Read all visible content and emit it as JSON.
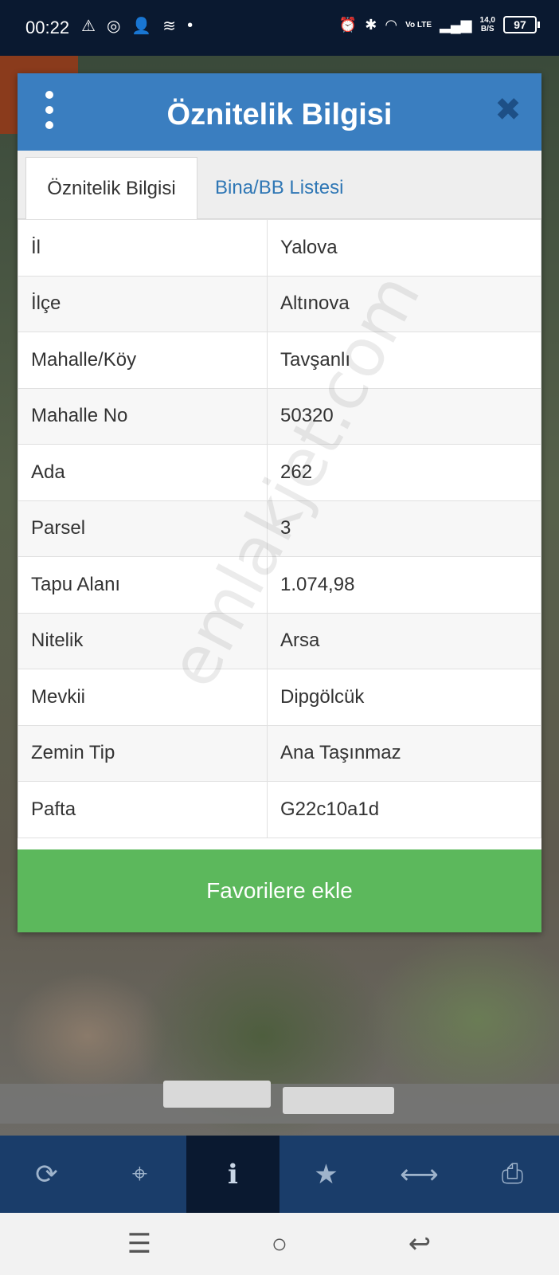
{
  "status_bar": {
    "time": "00:22",
    "left_icons": [
      "warning-icon",
      "chrome-icon",
      "person-add-icon",
      "signal-wave-icon",
      "dot-icon"
    ],
    "network_speed_value": "14,0",
    "network_speed_unit": "B/S",
    "battery": "97",
    "volte": "Vo LTE"
  },
  "dialog": {
    "title": "Öznitelik Bilgisi",
    "tabs": [
      {
        "label": "Öznitelik Bilgisi",
        "active": true
      },
      {
        "label": "Bina/BB Listesi",
        "active": false
      }
    ],
    "rows": [
      {
        "key": "İl",
        "value": "Yalova"
      },
      {
        "key": "İlçe",
        "value": "Altınova"
      },
      {
        "key": "Mahalle/Köy",
        "value": "Tavşanlı"
      },
      {
        "key": "Mahalle No",
        "value": "50320"
      },
      {
        "key": "Ada",
        "value": "262"
      },
      {
        "key": "Parsel",
        "value": "3"
      },
      {
        "key": "Tapu Alanı",
        "value": "1.074,98"
      },
      {
        "key": "Nitelik",
        "value": "Arsa"
      },
      {
        "key": "Mevkii",
        "value": "Dipgölcük"
      },
      {
        "key": "Zemin Tip",
        "value": "Ana Taşınmaz"
      },
      {
        "key": "Pafta",
        "value": "G22c10a1d"
      }
    ],
    "favorite_button": "Favorilere ekle"
  },
  "watermark": "emlakjet.com",
  "toolbar": {
    "items": [
      "refresh-icon",
      "locate-icon",
      "info-icon",
      "star-icon",
      "measure-icon",
      "print-icon"
    ],
    "active_index": 2
  },
  "colors": {
    "header": "#3a7ec0",
    "favorite_button": "#5cb85c",
    "toolbar": "#1a3d6a",
    "status_bar": "#0a1930"
  }
}
